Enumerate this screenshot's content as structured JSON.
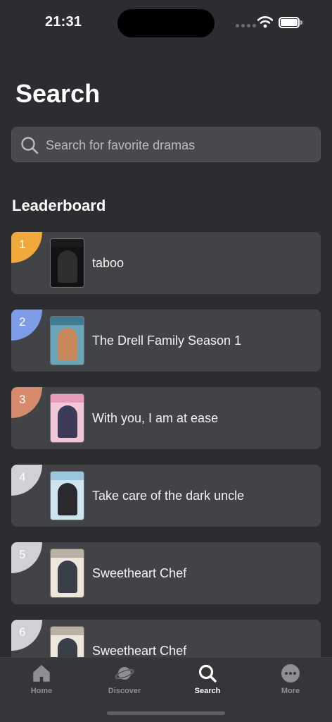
{
  "status_bar": {
    "time": "21:31"
  },
  "header": {
    "title": "Search"
  },
  "search": {
    "placeholder": "Search for favorite dramas"
  },
  "leaderboard": {
    "title": "Leaderboard",
    "items": [
      {
        "rank": "1",
        "title": "taboo",
        "badge_color": "#f0a93a",
        "poster": [
          "#121212",
          "#2e2e30",
          "#1a1a1a"
        ]
      },
      {
        "rank": "2",
        "title": "The Drell Family Season 1",
        "badge_color": "#7f9ce8",
        "poster": [
          "#6aa4b8",
          "#c8875a",
          "#3f7c94"
        ]
      },
      {
        "rank": "3",
        "title": "With you, I am at ease",
        "badge_color": "#d88a6c",
        "poster": [
          "#f3c6d6",
          "#3c3a56",
          "#e99cba"
        ]
      },
      {
        "rank": "4",
        "title": "Take care of the dark uncle",
        "badge_color": "#cfd1d4",
        "poster": [
          "#cfe4ef",
          "#2a2a2e",
          "#9ac7dc"
        ]
      },
      {
        "rank": "5",
        "title": "Sweetheart Chef",
        "badge_color": "#cfd1d4",
        "poster": [
          "#ece6dc",
          "#3a3f4a",
          "#b9b1a4"
        ]
      },
      {
        "rank": "6",
        "title": "Sweetheart Chef",
        "badge_color": "#cfd1d4",
        "poster": [
          "#ece6dc",
          "#3a3f4a",
          "#b9b1a4"
        ]
      }
    ]
  },
  "tabs": [
    {
      "label": "Home",
      "icon": "home-icon"
    },
    {
      "label": "Discover",
      "icon": "planet-icon"
    },
    {
      "label": "Search",
      "icon": "search-icon",
      "active": true
    },
    {
      "label": "More",
      "icon": "more-icon"
    }
  ]
}
